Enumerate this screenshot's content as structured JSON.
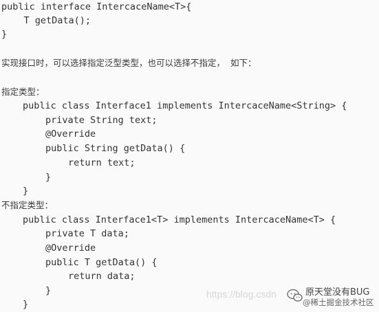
{
  "lines": [
    {
      "text": "public interface IntercaceName<T>{",
      "type": "code"
    },
    {
      "text": "    T getData();",
      "type": "code"
    },
    {
      "text": "}",
      "type": "code"
    },
    {
      "text": "",
      "type": "blank"
    },
    {
      "text": "实现接口时，可以选择指定泛型类型，也可以选择不指定，  如下：",
      "type": "text"
    },
    {
      "text": "",
      "type": "blank"
    },
    {
      "text": "指定类型：",
      "type": "text"
    },
    {
      "text": "public class Interface1 implements IntercaceName<String> {",
      "type": "code"
    },
    {
      "text": "private String text;",
      "type": "code"
    },
    {
      "text": "@Override",
      "type": "code"
    },
    {
      "text": "public String getData() {",
      "type": "code"
    },
    {
      "text": "return text;",
      "type": "code"
    },
    {
      "text": "}",
      "type": "code"
    },
    {
      "text": "}",
      "type": "code"
    },
    {
      "text": "不指定类型：",
      "type": "text"
    },
    {
      "text": "public class Interface1<T> implements IntercaceName<T> {",
      "type": "code"
    },
    {
      "text": "private T data;",
      "type": "code"
    },
    {
      "text": "@Override",
      "type": "code"
    },
    {
      "text": "public T getData() {",
      "type": "code"
    },
    {
      "text": "return data;",
      "type": "code"
    },
    {
      "text": "}",
      "type": "code"
    },
    {
      "text": "}",
      "type": "code"
    }
  ],
  "watermark": {
    "url": "https://blog.csdn",
    "account_name": "原天堂没有BUG",
    "site_name": "@稀土掘金技术社区"
  }
}
